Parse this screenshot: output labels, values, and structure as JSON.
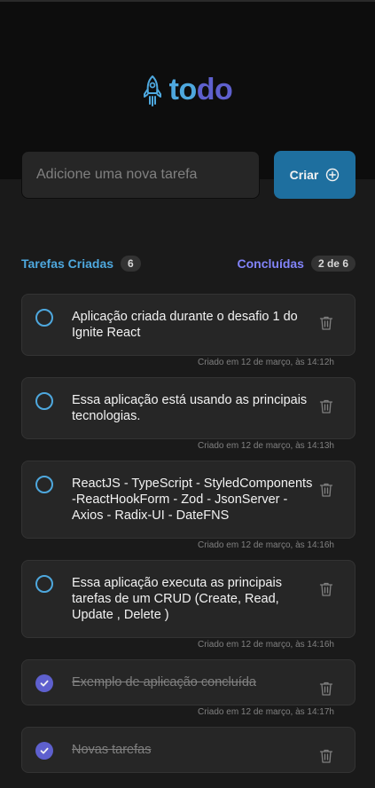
{
  "logo": {
    "to": "to",
    "do": "do",
    "icon": "rocket-icon"
  },
  "new_task": {
    "placeholder": "Adicione uma nova tarefa",
    "button_label": "Criar",
    "button_icon": "plus-circle-icon"
  },
  "counters": {
    "created_label": "Tarefas Criadas",
    "created_count": "6",
    "done_label": "Concluídas",
    "done_count": "2 de 6"
  },
  "tasks": [
    {
      "text": "Aplicação criada durante o desafio 1 do Ignite React",
      "completed": false,
      "created": "Criado em 12 de março, às 14:12h"
    },
    {
      "text": "Essa aplicação está usando as principais tecnologias.",
      "completed": false,
      "created": "Criado em 12 de março, às 14:13h"
    },
    {
      "text": "ReactJS - TypeScript - StyledComponents -ReactHookForm - Zod - JsonServer - Axios - Radix-UI - DateFNS",
      "completed": false,
      "created": "Criado em 12 de março, às 14:16h"
    },
    {
      "text": "Essa aplicação executa as principais tarefas de um CRUD (Create, Read, Update , Delete )",
      "completed": false,
      "created": "Criado em 12 de março, às 14:16h"
    },
    {
      "text": "Exemplo de aplicação concluída",
      "completed": true,
      "created": "Criado em 12 de março, às 14:17h"
    },
    {
      "text": "Novas tarefas",
      "completed": true,
      "created": ""
    }
  ],
  "colors": {
    "blue": "#4ea8de",
    "blue_dark": "#1e6f9f",
    "purple": "#5e60ce",
    "purple_light": "#8284fa"
  }
}
